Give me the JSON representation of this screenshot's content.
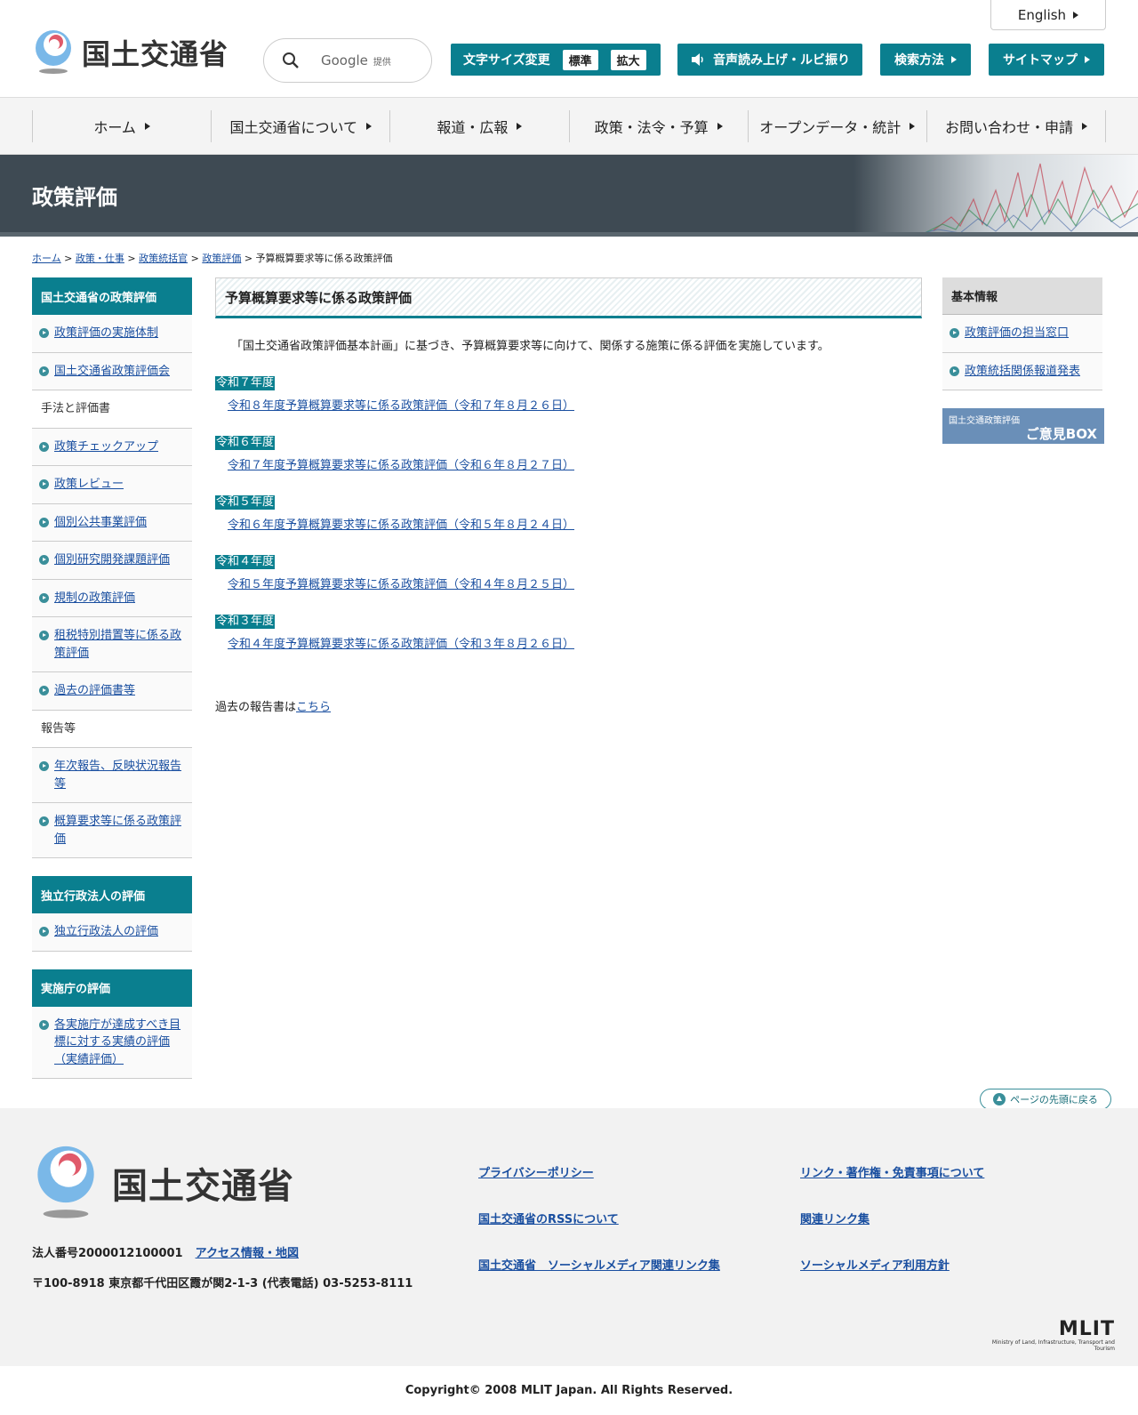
{
  "header": {
    "logo_text": "国土交通省",
    "search_google": "Google",
    "search_teikyo": "提供",
    "english": "English",
    "fontsize_label": "文字サイズ変更",
    "fontsize_standard": "標準",
    "fontsize_large": "拡大",
    "voice": "音声読み上げ・ルビ振り",
    "search_method": "検索方法",
    "sitemap": "サイトマップ"
  },
  "gnav": [
    "ホーム",
    "国土交通省について",
    "報道・広報",
    "政策・法令・予算",
    "オープンデータ・統計",
    "お問い合わせ・申請"
  ],
  "banner": {
    "title": "政策評価"
  },
  "breadcrumb": {
    "items": [
      "ホーム",
      "政策・仕事",
      "政策統括官",
      "政策評価"
    ],
    "current": "予算概算要求等に係る政策評価"
  },
  "left_sidebar": {
    "group1_title": "国土交通省の政策評価",
    "group1_items": [
      "政策評価の実施体制",
      "国土交通省政策評価会"
    ],
    "method_heading": "手法と評価書",
    "method_items": [
      "政策チェックアップ",
      "政策レビュー",
      "個別公共事業評価",
      "個別研究開発課題評価",
      "規制の政策評価",
      "租税特別措置等に係る政策評価",
      "過去の評価書等"
    ],
    "report_heading": "報告等",
    "report_items": [
      "年次報告、反映状況報告等",
      "概算要求等に係る政策評価"
    ],
    "group2_title": "独立行政法人の評価",
    "group2_items": [
      "独立行政法人の評価"
    ],
    "group3_title": "実施庁の評価",
    "group3_items": [
      "各実施庁が達成すべき目標に対する実績の評価（実績評価）"
    ]
  },
  "main": {
    "title": "予算概算要求等に係る政策評価",
    "intro": "「国土交通省政策評価基本計画」に基づき、予算概算要求等に向けて、関係する施策に係る評価を実施しています。",
    "years": [
      {
        "label": "令和７年度",
        "link": "令和８年度予算概算要求等に係る政策評価（令和７年８月２６日）"
      },
      {
        "label": "令和６年度",
        "link": "令和７年度予算概算要求等に係る政策評価（令和６年８月２７日）"
      },
      {
        "label": "令和５年度",
        "link": "令和６年度予算概算要求等に係る政策評価（令和５年８月２４日）"
      },
      {
        "label": "令和４年度",
        "link": "令和５年度予算概算要求等に係る政策評価（令和４年８月２５日）"
      },
      {
        "label": "令和３年度",
        "link": "令和４年度予算概算要求等に係る政策評価（令和３年８月２６日）"
      }
    ],
    "past_text": "過去の報告書は",
    "past_link": "こちら"
  },
  "right_sidebar": {
    "title": "基本情報",
    "items": [
      "政策評価の担当窓口",
      "政策統括関係報道発表"
    ],
    "opinion_small": "国土交通政策評価",
    "opinion_large": "ご意見BOX"
  },
  "to_top": "ページの先頭に戻る",
  "footer": {
    "logo_text": "国土交通省",
    "corp_no": "法人番号2000012100001",
    "access": "アクセス情報・地図",
    "address": "〒100-8918 東京都千代田区霞が関2-1-3 (代表電話) 03-5253-8111",
    "links": [
      "プライバシーポリシー",
      "リンク・著作権・免責事項について",
      "国土交通省のRSSについて",
      "関連リンク集",
      "国土交通省　ソーシャルメディア関連リンク集",
      "ソーシャルメディア利用方針"
    ],
    "mlit": "MLIT",
    "mlit_sub": "Ministry of Land, Infrastructure, Transport and Tourism",
    "copyright": "Copyright© 2008 MLIT Japan. All Rights Reserved."
  },
  "colors": {
    "accent": "#0a7f8f",
    "banner": "#3e4a53",
    "link": "#1a4fa0",
    "opinion": "#6a8fb8"
  }
}
